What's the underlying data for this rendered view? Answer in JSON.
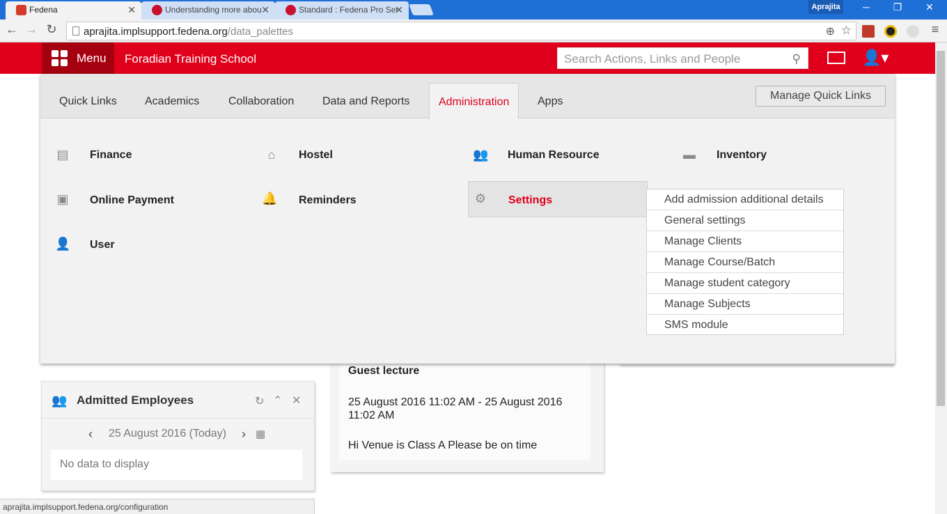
{
  "browser": {
    "tabs": [
      {
        "title": "Fedena",
        "fav_color": "#d33a2c"
      },
      {
        "title": "Understanding more abou",
        "fav_color": "#c8102e"
      },
      {
        "title": "Standard : Fedena Pro Ser",
        "fav_color": "#c8102e"
      }
    ],
    "profile_name": "Aprajita",
    "url_host": "aprajita.implsupport.fedena.org",
    "url_path": "/data_palettes",
    "status_url": "aprajita.implsupport.fedena.org/configuration"
  },
  "header": {
    "menu_label": "Menu",
    "school_name": "Foradian Training School",
    "search_placeholder": "Search Actions, Links and People",
    "brand_color": "#e0001b"
  },
  "menu": {
    "tabs": [
      "Quick Links",
      "Academics",
      "Collaboration",
      "Data and Reports",
      "Administration",
      "Apps"
    ],
    "active_tab": "Administration",
    "manage_quick_links": "Manage Quick Links",
    "modules": [
      {
        "label": "Finance",
        "icon": "finance-icon"
      },
      {
        "label": "Hostel",
        "icon": "hostel-icon"
      },
      {
        "label": "Human Resource",
        "icon": "human-resource-icon"
      },
      {
        "label": "Inventory",
        "icon": "inventory-icon"
      },
      {
        "label": "Online Payment",
        "icon": "online-payment-icon"
      },
      {
        "label": "Reminders",
        "icon": "bell-icon"
      },
      {
        "label": "Settings",
        "icon": "gear-icon"
      },
      {
        "label": "User",
        "icon": "user-icon"
      }
    ],
    "settings_submenu": [
      "Add admission additional details",
      "General settings",
      "Manage Clients",
      "Manage Course/Batch",
      "Manage student category",
      "Manage Subjects",
      "SMS module"
    ]
  },
  "widgets": {
    "admitted": {
      "title": "Admitted Employees",
      "date": "25 August 2016 (Today)",
      "empty": "No data to display"
    },
    "event": {
      "title": "Guest lecture",
      "time": "25 August 2016 11:02 AM - 25 August 2016 11:02 AM",
      "desc": "Hi Venue is Class A Please be on time"
    }
  }
}
